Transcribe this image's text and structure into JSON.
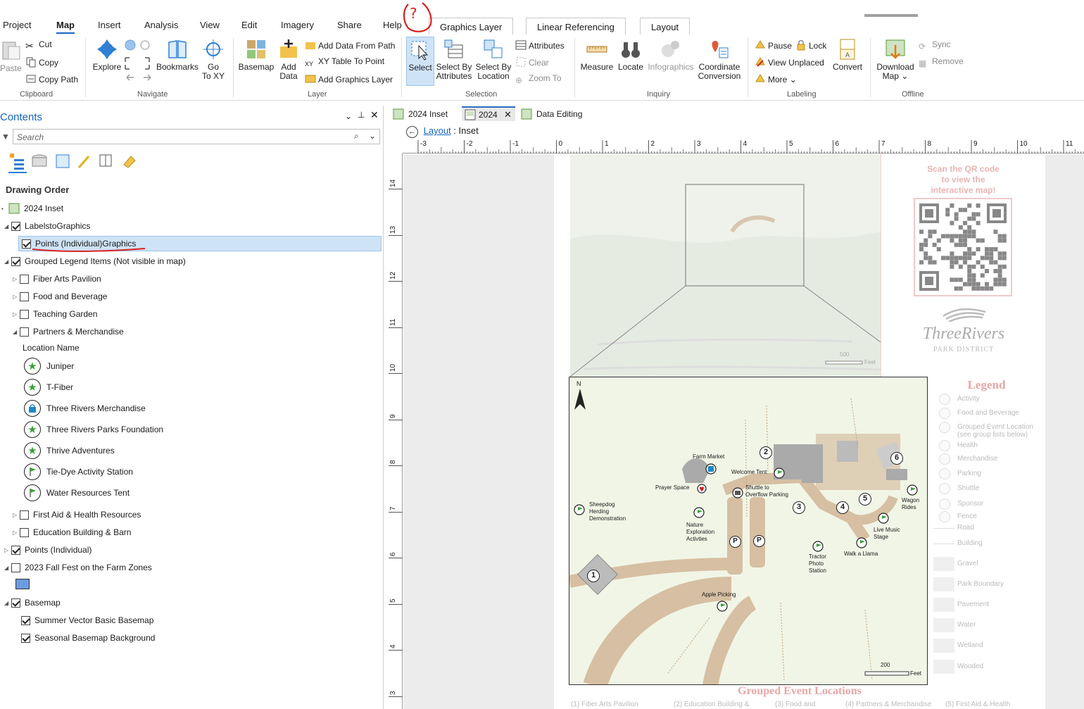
{
  "menu": {
    "items": [
      "Project",
      "Map",
      "Insert",
      "Analysis",
      "View",
      "Edit",
      "Imagery",
      "Share",
      "Help"
    ],
    "contextual_tabs": [
      "Graphics Layer",
      "Linear Referencing",
      "Layout"
    ]
  },
  "ribbon": {
    "clipboard": {
      "paste": "Paste",
      "cut": "Cut",
      "copy": "Copy",
      "copy_path": "Copy Path",
      "label": "Clipboard"
    },
    "navigate": {
      "explore": "Explore",
      "bookmarks": "Bookmarks",
      "go_to_xy_1": "Go",
      "go_to_xy_2": "To XY",
      "label": "Navigate"
    },
    "layer": {
      "basemap": "Basemap",
      "add_data_1": "Add",
      "add_data_2": "Data",
      "add_data_from_path": "Add Data From Path",
      "xy_table": "XY Table To Point",
      "add_graphics_layer": "Add Graphics Layer",
      "label": "Layer"
    },
    "selection": {
      "select": "Select",
      "select_by_attr_1": "Select By",
      "select_by_attr_2": "Attributes",
      "select_by_loc_1": "Select By",
      "select_by_loc_2": "Location",
      "attributes": "Attributes",
      "clear": "Clear",
      "zoom_to": "Zoom To",
      "label": "Selection"
    },
    "inquiry": {
      "measure": "Measure",
      "locate": "Locate",
      "infographics": "Infographics",
      "coord_1": "Coordinate",
      "coord_2": "Conversion",
      "label": "Inquiry"
    },
    "labeling": {
      "pause": "Pause",
      "lock": "Lock",
      "view_unplaced": "View Unplaced",
      "more": "More",
      "convert": "Convert",
      "label": "Labeling"
    },
    "offline": {
      "download_1": "Download",
      "download_2": "Map",
      "sync": "Sync",
      "remove": "Remove",
      "label": "Offline"
    }
  },
  "contents": {
    "title": "Contents",
    "search_placeholder": "Search",
    "drawing_order": "Drawing Order",
    "rows": [
      {
        "label": "2024 Inset",
        "checked": null
      },
      {
        "label": "LabelstoGraphics",
        "checked": true
      },
      {
        "label": "Points (Individual)Graphics",
        "checked": true,
        "selected": true
      },
      {
        "label": "Grouped Legend Items (Not visible in map)",
        "checked": true
      },
      {
        "label": "Fiber Arts Pavilion",
        "checked": false
      },
      {
        "label": "Food and Beverage",
        "checked": false
      },
      {
        "label": "Teaching Garden",
        "checked": false
      },
      {
        "label": "Partners & Merchandise",
        "checked": false
      },
      {
        "label": "Location Name",
        "checked": null
      },
      {
        "label": "Juniper",
        "symbol": "star"
      },
      {
        "label": "T-Fiber",
        "symbol": "star"
      },
      {
        "label": "Three Rivers Merchandise",
        "symbol": "bag"
      },
      {
        "label": "Three Rivers Parks Foundation",
        "symbol": "star"
      },
      {
        "label": "Thrive Adventures",
        "symbol": "star"
      },
      {
        "label": "Tie-Dye Activity Station",
        "symbol": "flag"
      },
      {
        "label": "Water Resources Tent",
        "symbol": "flag"
      },
      {
        "label": "First Aid & Health Resources",
        "checked": false
      },
      {
        "label": "Education Building & Barn",
        "checked": false
      },
      {
        "label": "Points (Individual)",
        "checked": true
      },
      {
        "label": "2023  Fall Fest on the Farm Zones",
        "checked": false
      },
      {
        "label": "Basemap",
        "checked": true
      },
      {
        "label": "Summer Vector Basic Basemap",
        "checked": true
      },
      {
        "label": "Seasonal Basemap Background",
        "checked": true
      }
    ]
  },
  "view_tabs": [
    "2024 Inset",
    "2024",
    "Data Editing"
  ],
  "breadcrumb": {
    "link": "Layout",
    "sep": ":",
    "current": "Inset"
  },
  "ruler_h": [
    "-3",
    "-2",
    "-1",
    "0",
    "1",
    "2",
    "3",
    "4",
    "5",
    "6",
    "7",
    "8",
    "9",
    "10",
    "11"
  ],
  "ruler_v": [
    "14",
    "13",
    "12",
    "11",
    "10",
    "9",
    "8",
    "7",
    "6",
    "5",
    "4",
    "3"
  ],
  "layout": {
    "qr_text_1": "Scan the QR code",
    "qr_text_2": "to view the",
    "qr_text_3": "interactive map!",
    "brand_1": "ThreeRivers",
    "brand_2": "PARK DISTRICT",
    "inset_scale": "500",
    "inset_scale_unit": "Feet",
    "main_scale": "200",
    "main_scale_unit": "Feet",
    "north": "N",
    "legend_title": "Legend",
    "legend_items": [
      "Activity",
      "Food and Beverage",
      "Grouped Event Location",
      "(see group lists below)",
      "Health",
      "Merchandise",
      "Parking",
      "Shuttle",
      "Sponsor",
      "Fence",
      "Road",
      "Building",
      "Gravel",
      "Park Boundary",
      "Pavement",
      "Water",
      "Wetland",
      "Wooded"
    ],
    "grouped_title": "Grouped Event Locations",
    "grouped_items": [
      "Fiber Arts Pavilion",
      "Education Building &",
      "Food and",
      "Partners & Merchandise",
      "First Aid & Health"
    ],
    "map_labels": {
      "farm_market": "Farm Market",
      "welcome_tent": "Welcome Tent",
      "prayer_space": "Prayer Space",
      "shuttle_1": "Shuttle to",
      "shuttle_2": "Overflow Parking",
      "sheepdog_1": "Sheepdog",
      "sheepdog_2": "Herding",
      "sheepdog_3": "Demonstration",
      "nature_1": "Nature",
      "nature_2": "Exploration",
      "nature_3": "Activties",
      "wagon_1": "Wagon",
      "wagon_2": "Rides",
      "music_1": "Live Music",
      "music_2": "Stage",
      "llama": "Walk a Llama",
      "tractor_1": "Tractor",
      "tractor_2": "Photo",
      "tractor_3": "Station",
      "apple": "Apple Picking",
      "n1": "1",
      "n2": "2",
      "n3": "3",
      "n4": "4",
      "n5": "5",
      "n6": "6",
      "p": "P"
    }
  },
  "annotation": "?"
}
